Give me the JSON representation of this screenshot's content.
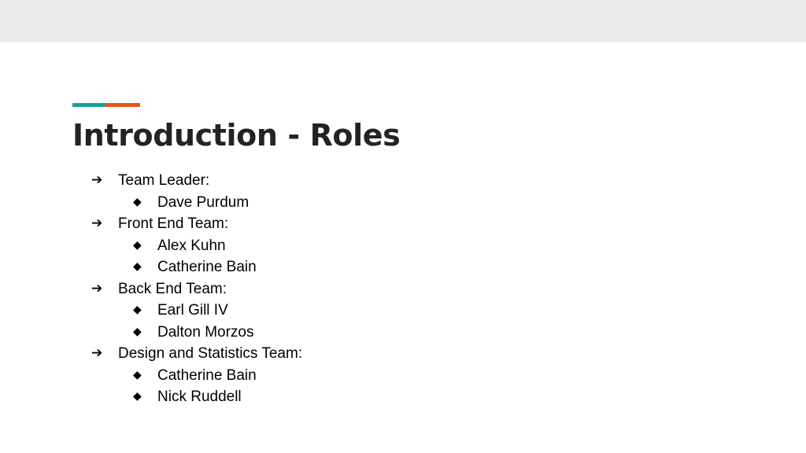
{
  "slide": {
    "top_band_color": "#e8eaeb",
    "background_color": "#ffffff",
    "title": "Introduction - Roles",
    "title_color": "#232323",
    "accent_rule": {
      "left_color": "#17a398",
      "right_color": "#e8561a"
    },
    "bullet_glyphs": {
      "level_1": "➔",
      "level_2": "◆"
    },
    "outline": [
      {
        "level": 1,
        "label": "Team Leader:"
      },
      {
        "level": 2,
        "label": "Dave Purdum"
      },
      {
        "level": 1,
        "label": "Front End Team:"
      },
      {
        "level": 2,
        "label": "Alex Kuhn"
      },
      {
        "level": 2,
        "label": "Catherine Bain"
      },
      {
        "level": 1,
        "label": "Back End Team:"
      },
      {
        "level": 2,
        "label": "Earl Gill IV"
      },
      {
        "level": 2,
        "label": "Dalton Morzos"
      },
      {
        "level": 1,
        "label": "Design and Statistics Team:"
      },
      {
        "level": 2,
        "label": "Catherine Bain"
      },
      {
        "level": 2,
        "label": "Nick Ruddell"
      }
    ]
  }
}
